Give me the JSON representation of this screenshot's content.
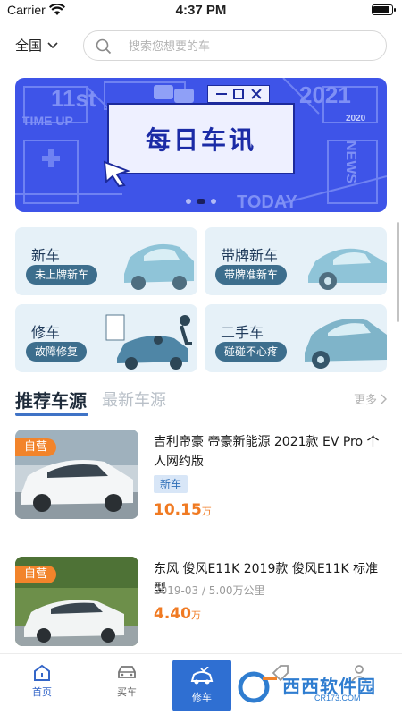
{
  "status_bar": {
    "carrier": "Carrier",
    "time": "4:37 PM"
  },
  "header": {
    "city": "全国",
    "search_placeholder": "搜索您想要的车"
  },
  "banner": {
    "title": "每日车讯",
    "deco_texts": [
      "11st",
      "2021",
      "TIME UP",
      "NEWS",
      "TODAY",
      "2020"
    ],
    "slide_count": 3,
    "active_slide": 1
  },
  "features": [
    {
      "title": "新车",
      "tag": "未上牌新车"
    },
    {
      "title": "带牌新车",
      "tag": "带牌准新车"
    },
    {
      "title": "修车",
      "tag": "故障修复"
    },
    {
      "title": "二手车",
      "tag": "碰碰不心疼"
    }
  ],
  "tabs": {
    "active": "推荐车源",
    "inactive": "最新车源",
    "more": "更多"
  },
  "cars": [
    {
      "badge": "自营",
      "name": "吉利帝豪 帝豪新能源 2021款 EV Pro 个人网约版",
      "tag": "新车",
      "price": "10.15",
      "unit": "万"
    },
    {
      "badge": "自营",
      "name": "东风 俊风E11K 2019款 俊风E11K 标准型",
      "meta": "2019-03 / 5.00万公里",
      "price": "4.40",
      "unit": "万"
    }
  ],
  "bottom_nav": {
    "home": "首页",
    "buy": "买车",
    "repair": "修车",
    "sell": "",
    "mine": ""
  },
  "watermark": {
    "text": "西西软件园",
    "url": "CR173.COM"
  },
  "colors": {
    "accent": "#3466c8",
    "banner": "#3e54e8",
    "price": "#f07a22",
    "badge": "#f2842b",
    "tile_bg": "#e6f1f8"
  }
}
